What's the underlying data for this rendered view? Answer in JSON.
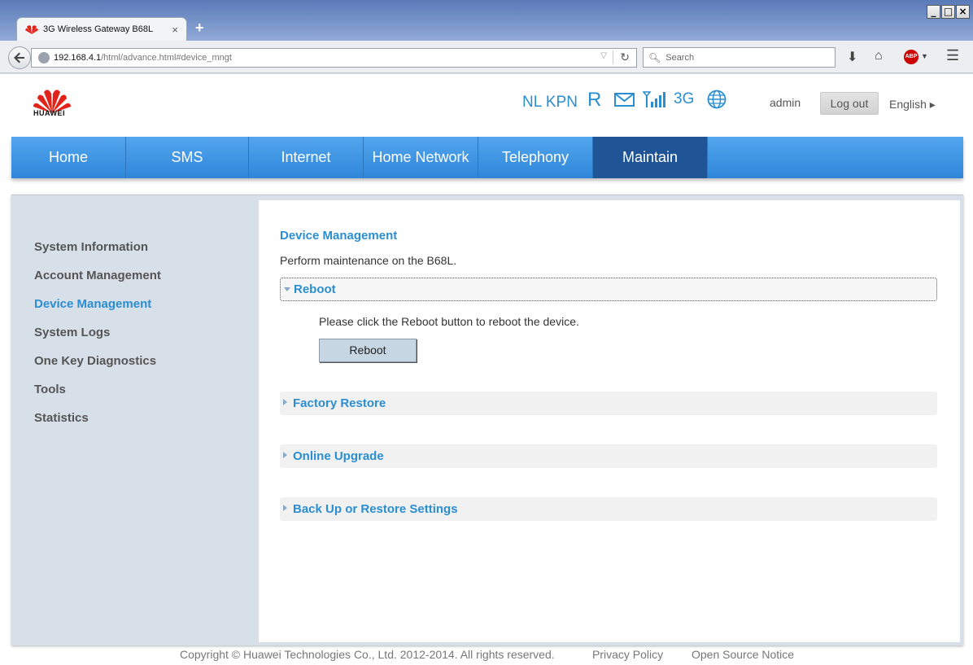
{
  "browser": {
    "tab_title": "3G Wireless Gateway B68L",
    "tab_close": "×",
    "new_tab": "+",
    "url_host": "192.168.4.1",
    "url_path": "/html/advance.html#device_mngt",
    "search_placeholder": "Search",
    "abp": "ABP",
    "win_min": "_",
    "win_max": "□",
    "win_close": "×"
  },
  "header": {
    "logo_text": "HUAWEI",
    "operator": "NL KPN",
    "roaming": "R",
    "network_type": "3G",
    "user": "admin",
    "logout": "Log out",
    "language": "English ▸"
  },
  "nav": {
    "items": [
      {
        "label": "Home"
      },
      {
        "label": "SMS"
      },
      {
        "label": "Internet"
      },
      {
        "label": "Home Network"
      },
      {
        "label": "Telephony"
      },
      {
        "label": "Maintain"
      }
    ]
  },
  "sidebar": {
    "items": [
      {
        "label": "System Information"
      },
      {
        "label": "Account Management"
      },
      {
        "label": "Device Management"
      },
      {
        "label": "System Logs"
      },
      {
        "label": "One Key Diagnostics"
      },
      {
        "label": "Tools"
      },
      {
        "label": "Statistics"
      }
    ]
  },
  "main": {
    "title": "Device Management",
    "description": "Perform maintenance on the B68L.",
    "sections": [
      {
        "label": "Reboot"
      },
      {
        "label": "Factory Restore"
      },
      {
        "label": "Online Upgrade"
      },
      {
        "label": "Back Up or Restore Settings"
      }
    ],
    "reboot_text": "Please click the Reboot button to reboot the device.",
    "reboot_button": "Reboot"
  },
  "footer": {
    "copyright": "Copyright © Huawei Technologies Co., Ltd. 2012-2014. All rights reserved.",
    "privacy": "Privacy Policy",
    "open_source": "Open Source Notice"
  },
  "colors": {
    "accent": "#2a8ed1",
    "nav_active": "#1f5596",
    "brand_red": "#e2231a"
  }
}
